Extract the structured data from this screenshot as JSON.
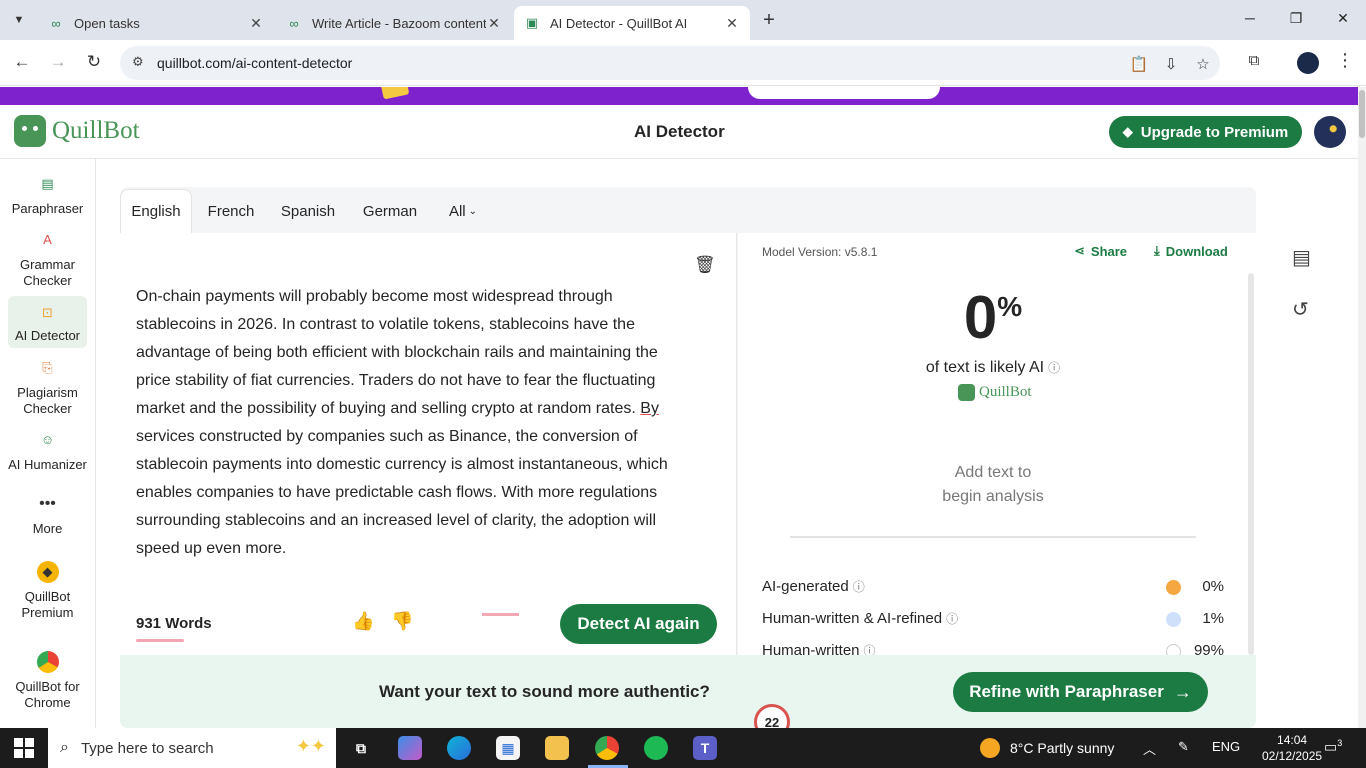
{
  "browser": {
    "tabs": [
      {
        "title": "Open tasks",
        "active": false
      },
      {
        "title": "Write Article - Bazoom content",
        "active": false
      },
      {
        "title": "AI Detector - QuillBot AI",
        "active": true
      }
    ],
    "url": "quillbot.com/ai-content-detector"
  },
  "header": {
    "logo": "QuillBot",
    "title": "AI Detector",
    "upgrade_label": "Upgrade to Premium"
  },
  "sidebar": {
    "items": [
      {
        "label": "Paraphraser",
        "icon": "paraphraser-icon"
      },
      {
        "label": "Grammar Checker",
        "icon": "grammar-icon"
      },
      {
        "label": "AI Detector",
        "icon": "ai-detector-icon"
      },
      {
        "label": "Plagiarism Checker",
        "icon": "plagiarism-icon"
      },
      {
        "label": "AI Humanizer",
        "icon": "humanizer-icon"
      },
      {
        "label": "More",
        "icon": "more-icon"
      },
      {
        "label": "QuillBot Premium",
        "icon": "premium-icon"
      },
      {
        "label": "QuillBot for Chrome",
        "icon": "chrome-icon"
      }
    ]
  },
  "languages": {
    "tabs": [
      "English",
      "French",
      "Spanish",
      "German"
    ],
    "all_label": "All",
    "selected": "English"
  },
  "editor": {
    "text_before": "On-chain payments will probably become most widespread through stablecoins in 2026. In contrast to volatile tokens, stablecoins have the advantage of being both efficient with blockchain rails and maintaining the price stability of fiat currencies. Traders do not have to fear the fluctuating market and the possibility of buying and selling crypto at random rates. ",
    "text_flagged": "By",
    "text_after": " services constructed by companies such as Binance, the conversion of stablecoin payments into domestic currency is almost instantaneous, which enables companies to have predictable cash flows. With more regulations surrounding stablecoins and an increased level of clarity, the adoption will speed up even more.",
    "word_count": "931 Words",
    "detect_label": "Detect AI again"
  },
  "results": {
    "model_version": "Model Version: v5.8.1",
    "share_label": "Share",
    "download_label": "Download",
    "percent": "0",
    "percent_sign": "%",
    "likely_label": "of text is likely AI",
    "brand": "QuillBot",
    "add_text_line1": "Add text to",
    "add_text_line2": "begin analysis",
    "stats": [
      {
        "label": "AI-generated",
        "value": "0%",
        "color": "#f5a742"
      },
      {
        "label": "Human-written & AI-refined",
        "value": "1%",
        "color": "#cfe0fb"
      },
      {
        "label": "Human-written",
        "value": "99%",
        "color": "#ffffff"
      }
    ]
  },
  "cta": {
    "text": "Want your text to sound more authentic?",
    "button": "Refine with Paraphraser"
  },
  "floating_badge": "22",
  "taskbar": {
    "search_placeholder": "Type here to search",
    "weather": "8°C  Partly sunny",
    "language": "ENG",
    "time": "14:04",
    "date": "02/12/2025",
    "notifications": "3"
  }
}
